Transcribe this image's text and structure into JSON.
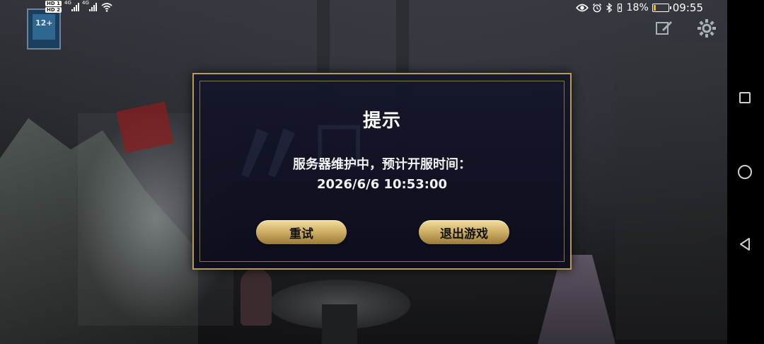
{
  "status_bar": {
    "sim1_label": "HD 1",
    "sim2_label": "HD 2",
    "network1": "4G",
    "network2": "4G",
    "battery_percent": "18%",
    "battery_level": 0.18,
    "time": "09:55",
    "icons": [
      "eye-icon",
      "alarm-icon",
      "bluetooth-icon",
      "vibrate-icon"
    ]
  },
  "game_badge": {
    "text": "12+"
  },
  "game_toolbar": {
    "icons": [
      "edit-icon",
      "settings-gear-icon"
    ]
  },
  "dialog": {
    "title": "提示",
    "message": "服务器维护中，预计开服时间：",
    "datetime": "2026/6/6  10:53:00",
    "retry_label": "重试",
    "exit_label": "退出游戏"
  },
  "navbar": {
    "icons": [
      "recent-apps-icon",
      "home-icon",
      "back-icon"
    ]
  },
  "colors": {
    "dialog_border": "#b99a59",
    "button_gold": "#d3b268",
    "battery_fill": "#f2b21c"
  }
}
